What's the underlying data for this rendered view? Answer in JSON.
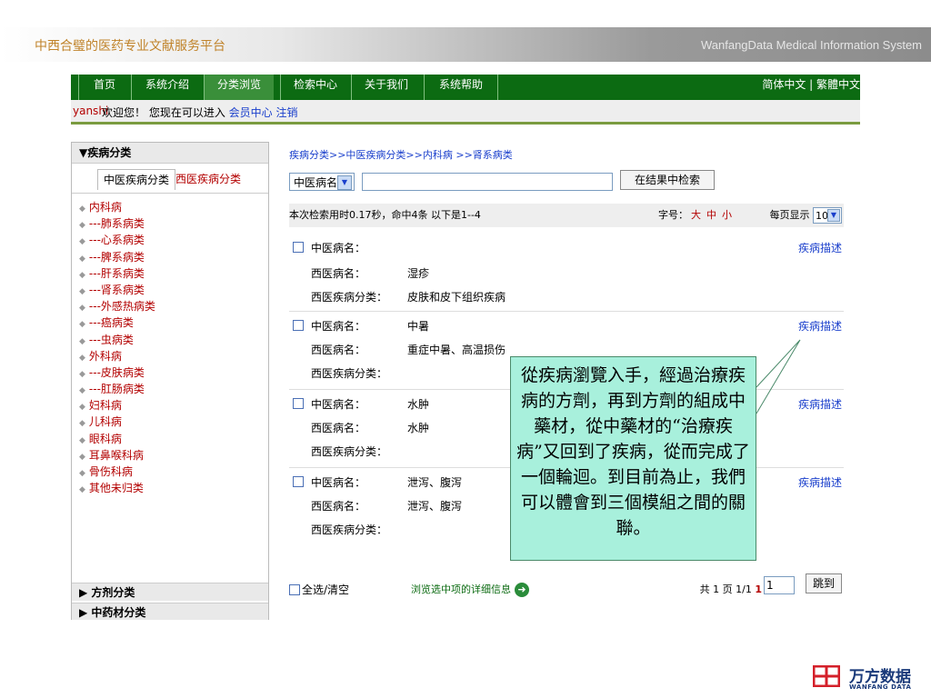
{
  "header": {
    "site_title": "中西合璧的医药专业文献服务平台",
    "system_name": "WanfangData Medical Information System"
  },
  "nav": {
    "items": [
      "首页",
      "系统介绍",
      "分类浏览",
      "检索中心",
      "关于我们",
      "系统帮助"
    ],
    "active_index": 2,
    "language": "简体中文 | 繁體中文"
  },
  "userbar": {
    "username": "yanshi",
    "welcome": "欢迎您！ 您现在可以进入",
    "member_center": "会员中心",
    "logout": "注销"
  },
  "sidebar": {
    "heading": "▼疾病分类",
    "tabs": [
      "中医疾病分类",
      "西医疾病分类"
    ],
    "items": [
      "内科病",
      "---肺系病类",
      "---心系病类",
      "---脾系病类",
      "---肝系病类",
      "---肾系病类",
      "---外感热病类",
      "---癌病类",
      "---虫病类",
      "外科病",
      "---皮肤病类",
      "---肛肠病类",
      "妇科病",
      "儿科病",
      "眼科病",
      "耳鼻喉科病",
      "骨伤科病",
      "其他未归类"
    ],
    "footer_sections": [
      "▶ 方剂分类",
      "▶ 中药材分类"
    ]
  },
  "main": {
    "breadcrumb": "疾病分类>>中医疾病分类>>内科病 >>肾系病类",
    "field_select": "中医病名",
    "search_value": "",
    "search_button": "在结果中检索",
    "status": "本次检索用时0.17秒，命中4条 以下是1--4",
    "font_size_label": "字号：",
    "font_sizes": [
      "大",
      "中",
      "小"
    ],
    "per_page_label": "每页显示",
    "per_page_value": "10",
    "records": [
      {
        "tcm_label": "中医病名：",
        "tcm_value": "",
        "wm_label": "西医病名：",
        "wm_value": "湿疹",
        "wm_cat_label": "西医疾病分类：",
        "wm_cat_value": "皮肤和皮下组织疾病",
        "desc_link": "疾病描述"
      },
      {
        "tcm_label": "中医病名：",
        "tcm_value": "中暑",
        "wm_label": "西医病名：",
        "wm_value": "重症中暑、高温损伤",
        "wm_cat_label": "西医疾病分类：",
        "wm_cat_value": "",
        "desc_link": "疾病描述"
      },
      {
        "tcm_label": "中医病名：",
        "tcm_value": "水肿",
        "wm_label": "西医病名：",
        "wm_value": "水肿",
        "wm_cat_label": "西医疾病分类：",
        "wm_cat_value": "",
        "desc_link": "疾病描述"
      },
      {
        "tcm_label": "中医病名：",
        "tcm_value": "泄泻、腹泻",
        "wm_label": "西医病名：",
        "wm_value": "泄泻、腹泻",
        "wm_cat_label": "西医疾病分类：",
        "wm_cat_value": "",
        "desc_link": "疾病描述"
      }
    ],
    "select_all": "全选/清空",
    "view_details": "浏览选中项的详细信息",
    "pager_text": "共 1 页 1/1",
    "pager_current": "1",
    "page_input": "1",
    "jump_button": "跳到"
  },
  "callout": {
    "text": "從疾病瀏覽入手，經過治療疾病的方劑，再到方劑的組成中藥材，從中藥材的“治療疾病”又回到了疾病，從而完成了一個輪迴。到目前為止，我們可以體會到三個模組之間的關聯。"
  },
  "logo": {
    "text": "万方数据",
    "subtext": "WANFANG DATA"
  }
}
